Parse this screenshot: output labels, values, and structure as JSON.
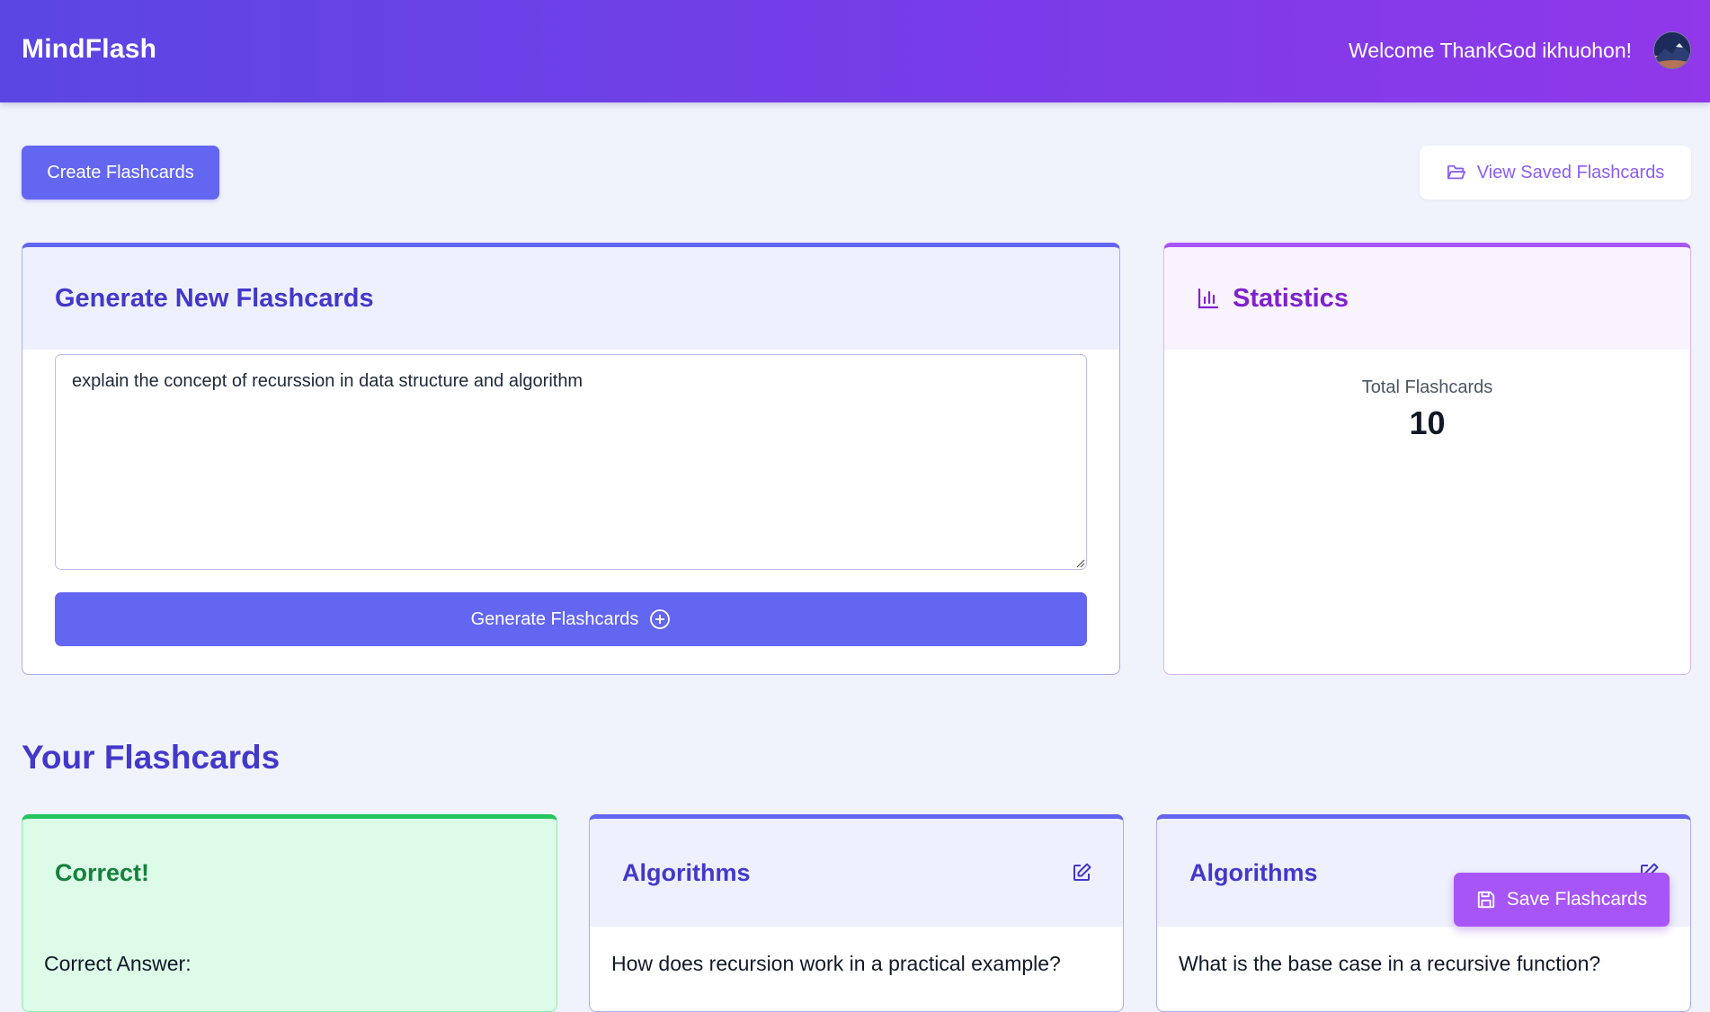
{
  "header": {
    "brand": "MindFlash",
    "welcome": "Welcome ThankGod ikhuohon!",
    "avatar_icon": "user-avatar-mountain"
  },
  "actions": {
    "create_label": "Create Flashcards",
    "view_saved_label": "View Saved Flashcards",
    "view_saved_icon": "folder-open-icon"
  },
  "generate": {
    "title": "Generate New Flashcards",
    "input_value": "explain the concept of recurssion in data structure and algorithm",
    "button_label": "Generate Flashcards",
    "button_icon": "plus-circle-icon"
  },
  "statistics": {
    "title": "Statistics",
    "icon": "bar-chart-icon",
    "total_label": "Total Flashcards",
    "total_value": "10"
  },
  "flashcards": {
    "section_title": "Your Flashcards",
    "items": [
      {
        "title": "Correct!",
        "text": "Correct Answer:"
      },
      {
        "title": "Algorithms",
        "text": "How does recursion work in a practical example?"
      },
      {
        "title": "Algorithms",
        "text": "What is the base case in a recursive function?"
      }
    ]
  },
  "save": {
    "label": "Save Flashcards",
    "icon": "save-icon"
  },
  "colors": {
    "primary": "#6366f1",
    "purple": "#a855f7",
    "heading": "#4338ca",
    "success_bg": "#dcfce7",
    "success_text": "#15803d"
  }
}
